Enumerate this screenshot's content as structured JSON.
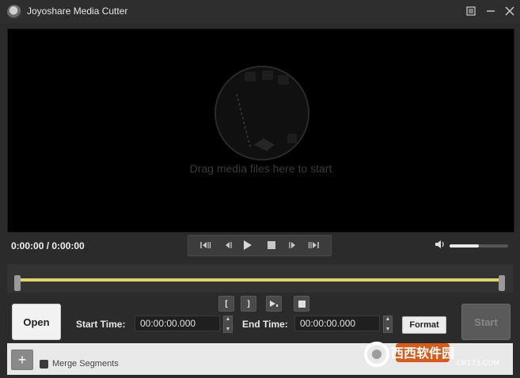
{
  "window": {
    "title": "Joyoshare Media Cutter",
    "menu_icon": "menu-icon",
    "minimize_icon": "minimize-icon",
    "close_icon": "close-icon"
  },
  "preview": {
    "drag_hint": "Drag media files here to start"
  },
  "playback": {
    "time": "0:00:00 / 0:00:00"
  },
  "marks": {
    "set_start_label": "[",
    "set_end_label": "]"
  },
  "actions": {
    "open_label": "Open",
    "start_label": "Start",
    "format_label": "Format"
  },
  "segment": {
    "start_time_label": "Start Time:",
    "start_time_value": "00:00:00.000",
    "end_time_label": "End Time:",
    "end_time_value": "00:00:00.000"
  },
  "bottom": {
    "add_label": "+",
    "merge_label": "Merge Segments"
  },
  "watermark": {
    "text_cn": "西西软件园",
    "text_en": "CR173.COM"
  },
  "colors": {
    "timeline": "#e0d56a",
    "background": "#2b2b2b",
    "preview": "#000000"
  },
  "volume": {
    "level": 0.5
  }
}
